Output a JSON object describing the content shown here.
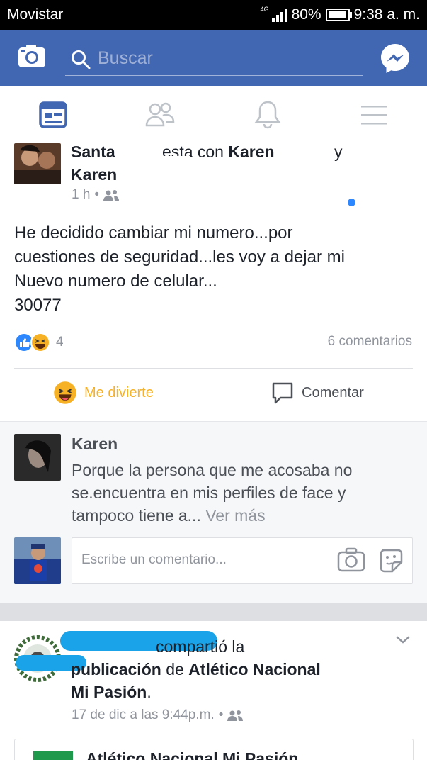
{
  "status_bar": {
    "carrier": "Movistar",
    "network": "4G",
    "battery": "80%",
    "time": "9:38 a. m."
  },
  "top_bar": {
    "search_placeholder": "Buscar",
    "bg_color": "#4267b2",
    "icons": [
      "camera-icon",
      "search-icon",
      "messenger-icon"
    ]
  },
  "nav_tabs": [
    "news-feed-icon",
    "friends-icon",
    "notifications-icon",
    "menu-icon"
  ],
  "post": {
    "author_first": "Santa ",
    "is_with": "esta con",
    "tagged_first": "Karen ",
    "and": "y",
    "tagged_second": "Karen ",
    "time": "1 h",
    "separator": "•",
    "body_lines": [
      "He decidido cambiar mi numero...por",
      "cuestiones de seguridad...les voy a dejar mi",
      "Nuevo numero de celular...",
      "30077"
    ],
    "reaction_count": "4",
    "comment_count": "6 comentarios",
    "actions": {
      "react_label": "Me divierte",
      "comment_label": "Comentar"
    }
  },
  "comment": {
    "author": "Karen ",
    "text_lines": [
      "Porque la persona que me acosaba no",
      "se.encuentra en mis perfiles de face y"
    ],
    "text_last": "tampoco tiene a...",
    "see_more": "Ver más",
    "input_placeholder": "Escribe un comentario..."
  },
  "post2": {
    "shared_verb": "compartió la",
    "publication_word": "publicación",
    "de": "de",
    "page_name_1": "Atlético Nacional",
    "page_name_2": "Mi Pasión",
    "period": ".",
    "date": "17 de dic a las 9:44p.m.",
    "separator": "•",
    "card_title": "Atlético Nacional Mi Pasión"
  },
  "colors": {
    "facebook_blue": "#4267b2",
    "haha_yellow": "#f7b125",
    "like_blue": "#2d88ff",
    "meta_gray": "#90949c",
    "active_tab": "#4267b2"
  }
}
